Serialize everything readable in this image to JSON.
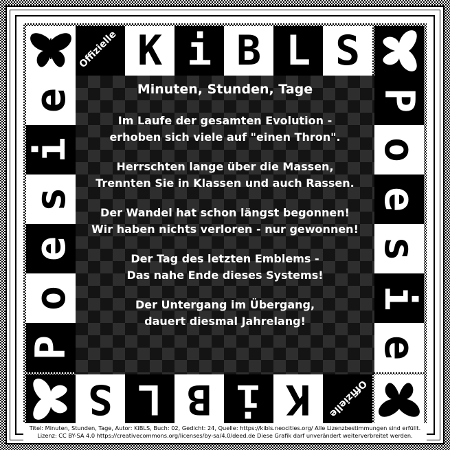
{
  "badges": {
    "top_left": "Offizielle",
    "bottom_right": "Offizielle"
  },
  "top_row": [
    "K",
    "i",
    "B",
    "L",
    "S"
  ],
  "bottom_row": [
    "K",
    "i",
    "B",
    "L",
    "S"
  ],
  "left_column": [
    "P",
    "o",
    "e",
    "s",
    "i",
    "e"
  ],
  "right_column": [
    "P",
    "o",
    "e",
    "s",
    "i",
    "e"
  ],
  "poem": {
    "title": "Minuten, Stunden, Tage",
    "stanzas": [
      [
        "Im Laufe der gesamten Evolution -",
        "erhoben sich viele auf \"einen Thron\"."
      ],
      [
        "Herrschten lange über die Massen,",
        "Trennten Sie in Klassen und auch Rassen."
      ],
      [
        "Der Wandel hat schon längst begonnen!",
        "Wir haben nichts verloren - nur gewonnen!"
      ],
      [
        "Der Tag des letzten Emblems -",
        "Das nahe Ende dieses Systems!"
      ],
      [
        "Der Untergang im Übergang,",
        "dauert diesmal Jahrelang!"
      ]
    ]
  },
  "footer": {
    "line1": "Titel: Minuten, Stunden, Tage, Autor: KiBLS, Buch: 02, Gedicht: 24, Quelle: https://kibls.neocities.org/ Alle Lizenzbestimmungen sind erfüllt.",
    "line2": "Lizenz: CC BY-SA 4.0 https://creativecommons.org/licenses/by-sa/4.0/deed.de Diese Grafik darf unverändert weiterverbreitet werden."
  },
  "icons": [
    "butterfly-icon",
    "butterfly-icon",
    "butterfly-icon",
    "butterfly-icon"
  ],
  "colors": {
    "black": "#000000",
    "white": "#ffffff"
  }
}
